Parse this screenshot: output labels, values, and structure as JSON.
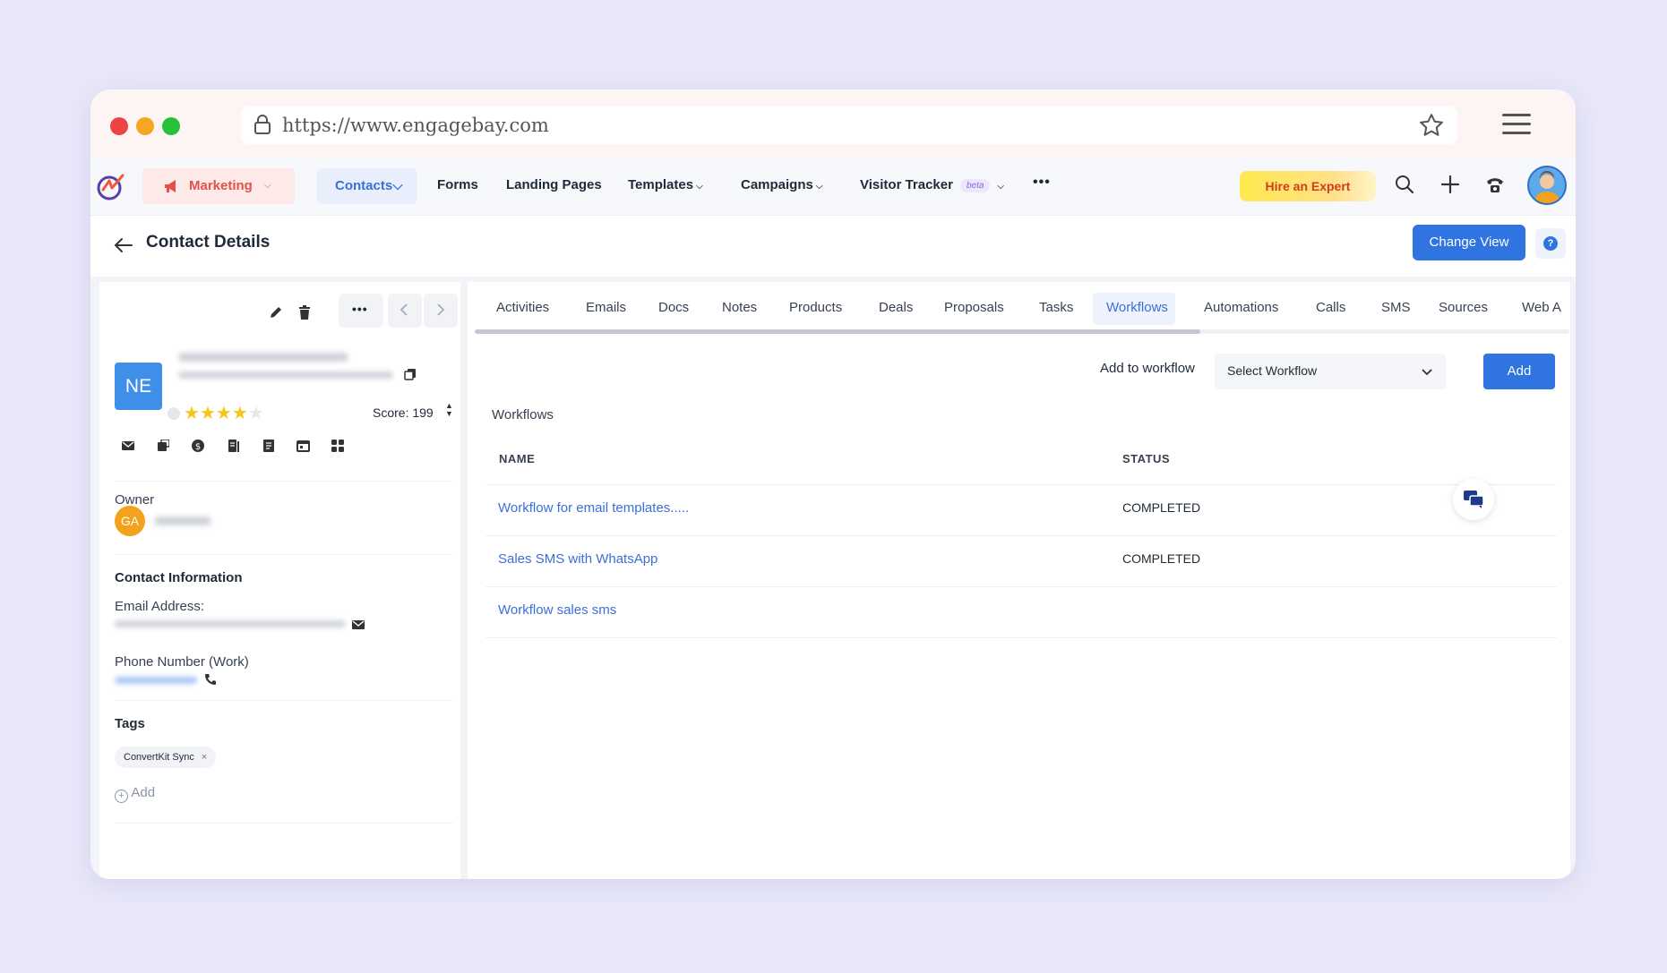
{
  "browser": {
    "url": "https://www.engagebay.com"
  },
  "nav": {
    "module": "Marketing",
    "contacts": "Contacts",
    "forms": "Forms",
    "landing_pages": "Landing Pages",
    "templates": "Templates",
    "campaigns": "Campaigns",
    "visitor_tracker": "Visitor Tracker",
    "beta": "beta",
    "more": "•••",
    "hire_expert": "Hire an Expert"
  },
  "page": {
    "title": "Contact Details",
    "change_view": "Change View",
    "help": "?"
  },
  "contact": {
    "initials": "NE",
    "rating": 4,
    "max_rating": 5,
    "score_label": "Score: 199",
    "owner_label": "Owner",
    "owner_initials": "GA",
    "contact_info_title": "Contact Information",
    "email_label": "Email Address:",
    "phone_label": "Phone Number (Work)",
    "tags_title": "Tags",
    "tags": [
      "ConvertKit Sync"
    ],
    "add_tag": "Add"
  },
  "tabs": [
    "Activities",
    "Emails",
    "Docs",
    "Notes",
    "Products",
    "Deals",
    "Proposals",
    "Tasks",
    "Workflows",
    "Automations",
    "Calls",
    "SMS",
    "Sources",
    "Web A"
  ],
  "active_tab": "Workflows",
  "workflows": {
    "add_label": "Add to workflow",
    "select_placeholder": "Select Workflow",
    "add_button": "Add",
    "section_title": "Workflows",
    "columns": [
      "NAME",
      "STATUS"
    ],
    "rows": [
      {
        "name": "Workflow for email templates.....",
        "status": "COMPLETED"
      },
      {
        "name": "Sales SMS with WhatsApp",
        "status": "COMPLETED"
      },
      {
        "name": "Workflow sales sms",
        "status": ""
      }
    ]
  },
  "colors": {
    "primary": "#2f74e0",
    "link": "#3b6fd8",
    "star": "#f5c518",
    "marketing": "#e2524a",
    "hire_text": "#d23c1e"
  }
}
